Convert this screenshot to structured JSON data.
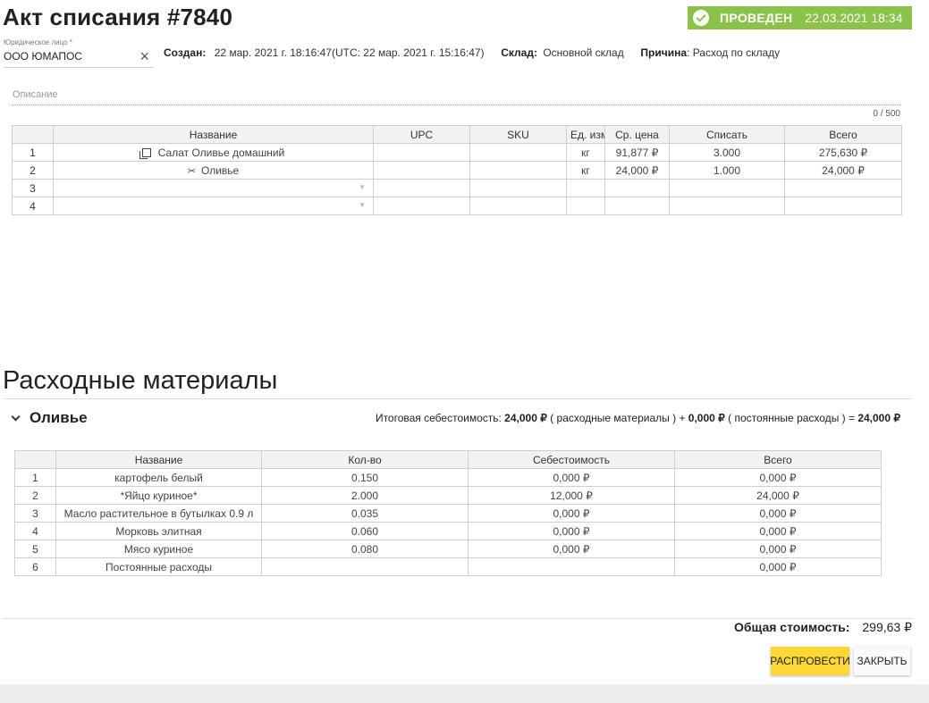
{
  "header": {
    "title": "Акт списания #7840",
    "status": {
      "label": "ПРОВЕДЕН",
      "date": "22.03.2021 18:34",
      "color": "#8bc34a",
      "icon": "check-circle-icon"
    }
  },
  "legal_entity": {
    "label": "Юридическое лицо *",
    "value": "ООО ЮМАПОС"
  },
  "meta": {
    "created_label": "Создан:",
    "created_value": "22 мар. 2021 г. 18:16:47(UTC: 22 мар. 2021 г. 15:16:47)",
    "warehouse_label": "Склад:",
    "warehouse_value": "Основной склад",
    "reason_label": "Причина",
    "reason_value": ": Расход по складу"
  },
  "description": {
    "placeholder": "Описание",
    "counter": "0 / 500"
  },
  "items_table": {
    "columns": [
      "Название",
      "UPC",
      "SKU",
      "Ед. изм",
      "Ср. цена",
      "Списать",
      "Всего"
    ],
    "rows": [
      {
        "num": "1",
        "icon": "copy-icon",
        "name": "Салат Оливье домашний",
        "upc": "",
        "sku": "",
        "unit": "кг",
        "price": "91,877 ₽",
        "qty": "3.000",
        "total": "275,630 ₽"
      },
      {
        "num": "2",
        "icon": "utensils-icon",
        "name": "Оливье",
        "upc": "",
        "sku": "",
        "unit": "кг",
        "price": "24,000 ₽",
        "qty": "1.000",
        "total": "24,000 ₽"
      },
      {
        "num": "3"
      },
      {
        "num": "4"
      }
    ]
  },
  "materials": {
    "section_title": "Расходные материалы",
    "group_name": "Оливье",
    "summary": {
      "label": "Итоговая себестоимость:",
      "materials_value": "24,000 ₽",
      "materials_text": "( расходные материалы ) +",
      "fixed_value": "0,000 ₽",
      "fixed_text": "( постоянные расходы ) =",
      "total_value": "24,000 ₽"
    },
    "columns": [
      "Название",
      "Кол-во",
      "Себестоимость",
      "Всего"
    ],
    "rows": [
      {
        "num": "1",
        "name": "картофель белый",
        "qty": "0.150",
        "cost": "0,000 ₽",
        "total": "0,000 ₽"
      },
      {
        "num": "2",
        "name": "*Яйцо куриное*",
        "qty": "2.000",
        "cost": "12,000 ₽",
        "total": "24,000 ₽"
      },
      {
        "num": "3",
        "name": "Масло растительное в бутылках 0.9 л",
        "qty": "0.035",
        "cost": "0,000 ₽",
        "total": "0,000 ₽"
      },
      {
        "num": "4",
        "name": "Морковь элитная",
        "qty": "0.060",
        "cost": "0,000 ₽",
        "total": "0,000 ₽"
      },
      {
        "num": "5",
        "name": "Мясо куриное",
        "qty": "0.080",
        "cost": "0,000 ₽",
        "total": "0,000 ₽"
      },
      {
        "num": "6",
        "name": "Постоянные расходы",
        "qty": "",
        "cost": "",
        "total": "0,000 ₽"
      }
    ]
  },
  "footer": {
    "total_label": "Общая стоимость:",
    "total_value": "299,63 ₽",
    "unpost_button": "РАСПРОВЕСТИ",
    "close_button": "ЗАКРЫТЬ",
    "unpost_color": "#fdd835"
  }
}
